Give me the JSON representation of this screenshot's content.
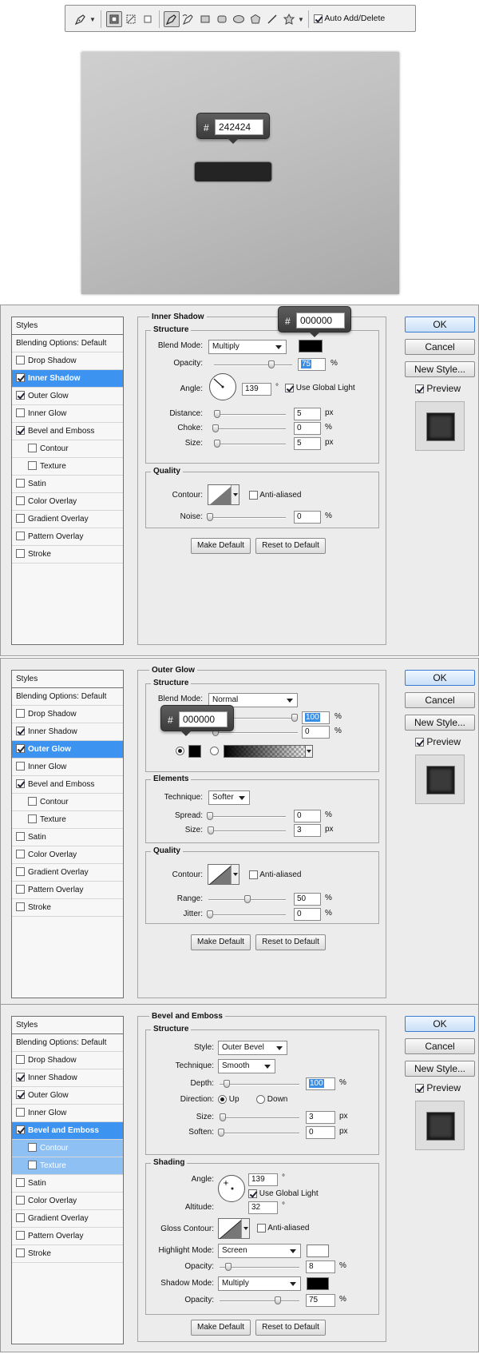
{
  "toolbar": {
    "auto_add_delete_label": "Auto Add/Delete",
    "auto_add_delete_checked": true,
    "icons": [
      "pen-tool-icon",
      "dropdown-arrow-icon",
      "shape-layers-icon",
      "paths-icon",
      "fill-pixels-icon",
      "pen-icon",
      "freeform-pen-icon",
      "rectangle-icon",
      "rounded-rectangle-icon",
      "ellipse-icon",
      "polygon-icon",
      "line-icon",
      "custom-shape-icon",
      "dropdown-arrow-icon"
    ]
  },
  "canvas": {
    "bubble_hash": "#",
    "bubble_hex": "242424",
    "shape_color": "#242424"
  },
  "panel1": {
    "styles_header": "Styles",
    "blending": "Blending Options: Default",
    "items": [
      "Drop Shadow",
      "Inner Shadow",
      "Outer Glow",
      "Inner Glow",
      "Bevel and Emboss",
      "Contour",
      "Texture",
      "Satin",
      "Color Overlay",
      "Gradient Overlay",
      "Pattern Overlay",
      "Stroke"
    ],
    "title": "Inner Shadow",
    "structure": "Structure",
    "blend_mode_label": "Blend Mode:",
    "blend_mode": "Multiply",
    "opacity_label": "Opacity:",
    "opacity": "75",
    "opacity_value": 75,
    "angle_label": "Angle:",
    "angle": "139",
    "deg": "°",
    "use_global_light": "Use Global Light",
    "distance_label": "Distance:",
    "distance": "5",
    "choke_label": "Choke:",
    "choke": "0",
    "size_label": "Size:",
    "size": "5",
    "px": "px",
    "pct": "%",
    "quality": "Quality",
    "contour_label": "Contour:",
    "anti_aliased": "Anti-aliased",
    "noise_label": "Noise:",
    "noise": "0",
    "make_default": "Make Default",
    "reset_default": "Reset to Default",
    "bubble_hash": "#",
    "bubble_hex": "000000"
  },
  "panel2": {
    "title": "Outer Glow",
    "structure": "Structure",
    "blend_mode_label": "Blend Mode:",
    "blend_mode": "Normal",
    "opacity": "100",
    "opacity_value": 100,
    "noise": "0",
    "elements": "Elements",
    "technique_label": "Technique:",
    "technique": "Softer",
    "spread_label": "Spread:",
    "spread": "0",
    "size_label": "Size:",
    "size": "3",
    "quality": "Quality",
    "contour_label": "Contour:",
    "anti_aliased": "Anti-aliased",
    "range_label": "Range:",
    "range": "50",
    "range_value": 50,
    "jitter_label": "Jitter:",
    "jitter": "0",
    "bubble_hash": "#",
    "bubble_hex": "000000"
  },
  "panel3": {
    "title": "Bevel and Emboss",
    "structure": "Structure",
    "style_label": "Style:",
    "style": "Outer Bevel",
    "technique_label": "Technique:",
    "technique": "Smooth",
    "depth_label": "Depth:",
    "depth": "100",
    "direction_label": "Direction:",
    "up": "Up",
    "down": "Down",
    "size_label": "Size:",
    "size": "3",
    "soften_label": "Soften:",
    "soften": "0",
    "shading": "Shading",
    "angle_label": "Angle:",
    "angle": "139",
    "use_global_light": "Use Global Light",
    "altitude_label": "Altitude:",
    "altitude": "32",
    "gloss_contour_label": "Gloss Contour:",
    "anti_aliased": "Anti-aliased",
    "highlight_mode_label": "Highlight Mode:",
    "highlight_mode": "Screen",
    "highlight_opacity": "8",
    "opacity_label": "Opacity:",
    "shadow_mode_label": "Shadow Mode:",
    "shadow_mode": "Multiply",
    "shadow_opacity": "75",
    "shadow_opacity_value": 75
  },
  "buttons": {
    "ok": "OK",
    "cancel": "Cancel",
    "new_style": "New Style...",
    "preview": "Preview"
  }
}
